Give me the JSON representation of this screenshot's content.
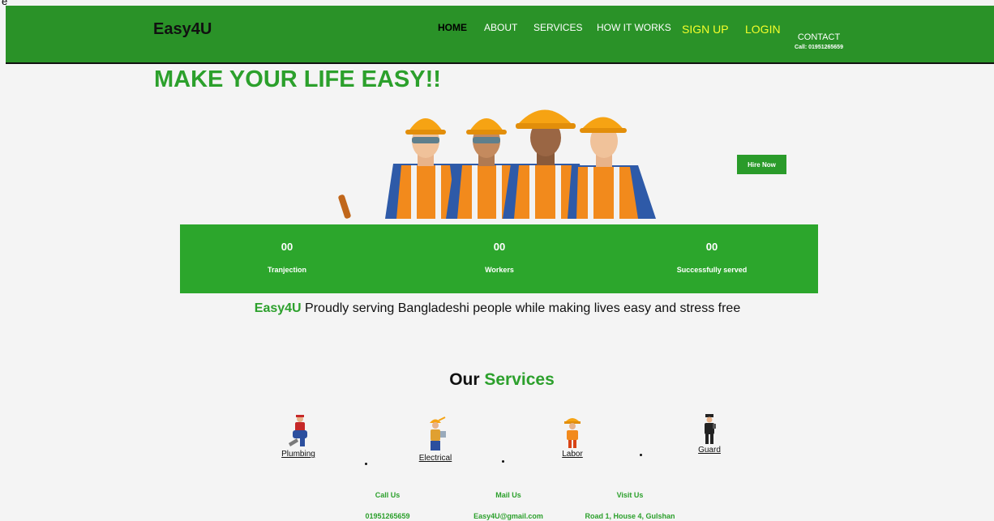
{
  "corner_text": "e",
  "header": {
    "brand": "Easy4U",
    "nav": {
      "home": "HOME",
      "about": "ABOUT",
      "services": "SERVICES",
      "how_it_works": "HOW IT WORKS",
      "sign_up": "SIGN UP",
      "login": "LOGIN"
    },
    "contact": {
      "label": "CONTACT",
      "phone": "Call: 01951265659"
    }
  },
  "hero": {
    "headline": "MAKE YOUR LIFE EASY!!",
    "hire_button": "Hire Now"
  },
  "stats": [
    {
      "value": "00",
      "label": "Tranjection"
    },
    {
      "value": "00",
      "label": "Workers"
    },
    {
      "value": "00",
      "label": "Successfully served"
    }
  ],
  "tagline": {
    "brand": "Easy4U",
    "text": " Proudly serving Bangladeshi people while making lives easy and stress free"
  },
  "services": {
    "title_part1": "Our ",
    "title_part2": "Services",
    "items": [
      {
        "label": "Plumbing",
        "icon": "plumber-icon"
      },
      {
        "label": "Electrical",
        "icon": "electrician-icon"
      },
      {
        "label": "Labor",
        "icon": "laborer-icon"
      },
      {
        "label": "Guard",
        "icon": "guard-icon"
      }
    ]
  },
  "footer": {
    "call_label": "Call Us",
    "call_value": "01951265659",
    "mail_label": "Mail Us",
    "mail_value": "Easy4U@gmail.com",
    "visit_label": "Visit Us",
    "visit_value": "Road 1, House 4, Gulshan"
  },
  "colors": {
    "brand_green": "#2a9228",
    "accent_green": "#2ca02c",
    "highlight_yellow": "#f4ff2a"
  }
}
